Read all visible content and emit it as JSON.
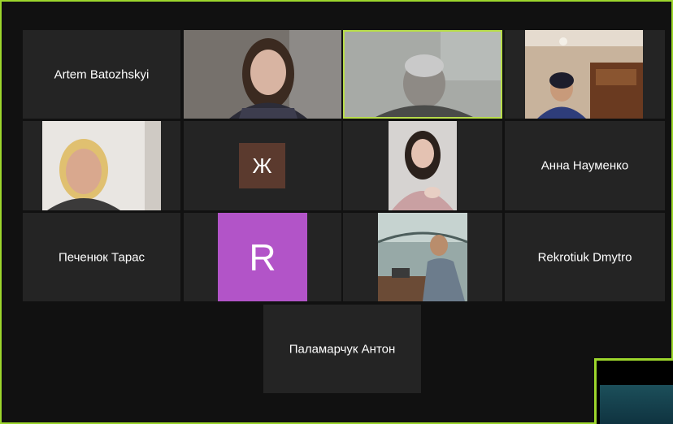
{
  "meeting": {
    "accent_color": "#9cd62c",
    "tile_color": "#242424",
    "participants": [
      {
        "name": "Artem Batozhskyi",
        "type": "name-only"
      },
      {
        "name": "",
        "type": "video",
        "icon": "video-feed"
      },
      {
        "name": "",
        "type": "video",
        "icon": "video-feed",
        "active_speaker": true
      },
      {
        "name": "",
        "type": "video",
        "icon": "video-feed"
      },
      {
        "name": "",
        "type": "video",
        "icon": "video-feed"
      },
      {
        "name": "",
        "type": "avatar",
        "initial": "Ж",
        "color": "#5b3a2e"
      },
      {
        "name": "",
        "type": "video",
        "icon": "video-feed"
      },
      {
        "name": "Анна Науменко",
        "type": "name-only"
      },
      {
        "name": "Печенюк Тарас",
        "type": "name-only"
      },
      {
        "name": "",
        "type": "avatar",
        "initial": "R",
        "color": "#b254c8"
      },
      {
        "name": "",
        "type": "video",
        "icon": "video-feed"
      },
      {
        "name": "Rekrotiuk Dmytro",
        "type": "name-only"
      },
      {
        "name": "Паламарчук Антон",
        "type": "name-only"
      }
    ]
  }
}
